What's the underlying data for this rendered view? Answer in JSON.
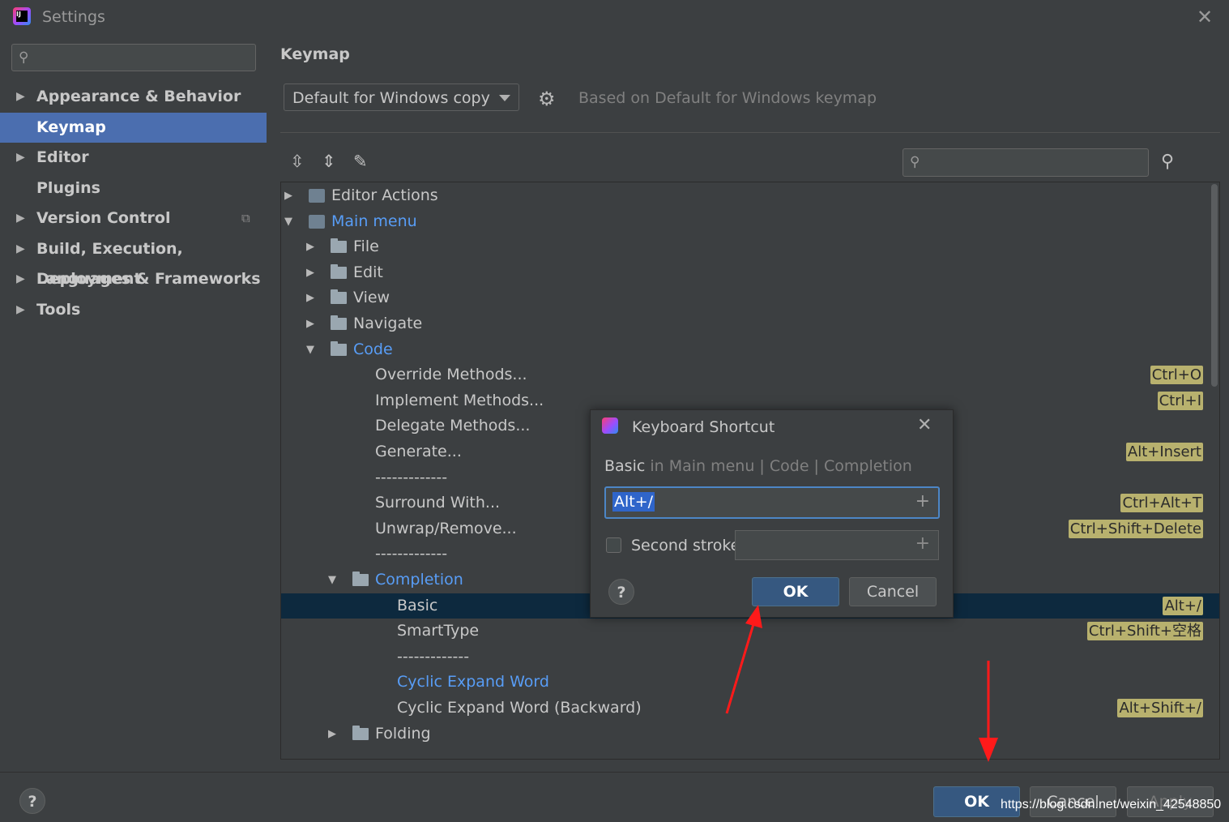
{
  "window": {
    "title": "Settings",
    "close_icon": "close-icon"
  },
  "sidebar": {
    "search_placeholder": "",
    "items": [
      {
        "label": "Appearance & Behavior",
        "expandable": true,
        "selected": false
      },
      {
        "label": "Keymap",
        "expandable": false,
        "selected": true
      },
      {
        "label": "Editor",
        "expandable": true,
        "selected": false
      },
      {
        "label": "Plugins",
        "expandable": false,
        "selected": false
      },
      {
        "label": "Version Control",
        "expandable": true,
        "selected": false
      },
      {
        "label": "Build, Execution, Deployment",
        "expandable": true,
        "selected": false
      },
      {
        "label": "Languages & Frameworks",
        "expandable": true,
        "selected": false
      },
      {
        "label": "Tools",
        "expandable": true,
        "selected": false
      }
    ]
  },
  "main": {
    "title": "Keymap",
    "keymap_value": "Default for Windows copy",
    "based_on": "Based on Default for Windows keymap",
    "tree": [
      {
        "label": "Editor Actions",
        "indent": 0,
        "arrow": "right",
        "icon": "editor",
        "blue": false,
        "shortcut": ""
      },
      {
        "label": "Main menu",
        "indent": 0,
        "arrow": "down",
        "icon": "menu",
        "blue": true,
        "shortcut": ""
      },
      {
        "label": "File",
        "indent": 1,
        "arrow": "right",
        "icon": "folder",
        "blue": false,
        "shortcut": ""
      },
      {
        "label": "Edit",
        "indent": 1,
        "arrow": "right",
        "icon": "folder",
        "blue": false,
        "shortcut": ""
      },
      {
        "label": "View",
        "indent": 1,
        "arrow": "right",
        "icon": "folder",
        "blue": false,
        "shortcut": ""
      },
      {
        "label": "Navigate",
        "indent": 1,
        "arrow": "right",
        "icon": "folder",
        "blue": false,
        "shortcut": ""
      },
      {
        "label": "Code",
        "indent": 1,
        "arrow": "down",
        "icon": "folder",
        "blue": true,
        "shortcut": ""
      },
      {
        "label": "Override Methods...",
        "indent": 2,
        "arrow": "",
        "icon": "",
        "blue": false,
        "shortcut": "Ctrl+O"
      },
      {
        "label": "Implement Methods...",
        "indent": 2,
        "arrow": "",
        "icon": "",
        "blue": false,
        "shortcut": "Ctrl+I"
      },
      {
        "label": "Delegate Methods...",
        "indent": 2,
        "arrow": "",
        "icon": "",
        "blue": false,
        "shortcut": ""
      },
      {
        "label": "Generate...",
        "indent": 2,
        "arrow": "",
        "icon": "",
        "blue": false,
        "shortcut": "Alt+Insert"
      },
      {
        "label": "-------------",
        "indent": 2,
        "arrow": "",
        "icon": "",
        "blue": false,
        "shortcut": ""
      },
      {
        "label": "Surround With...",
        "indent": 2,
        "arrow": "",
        "icon": "",
        "blue": false,
        "shortcut": "Ctrl+Alt+T"
      },
      {
        "label": "Unwrap/Remove...",
        "indent": 2,
        "arrow": "",
        "icon": "",
        "blue": false,
        "shortcut": "Ctrl+Shift+Delete"
      },
      {
        "label": "-------------",
        "indent": 2,
        "arrow": "",
        "icon": "",
        "blue": false,
        "shortcut": ""
      },
      {
        "label": "Completion",
        "indent": 2,
        "arrow": "down",
        "icon": "folder",
        "blue": true,
        "shortcut": ""
      },
      {
        "label": "Basic",
        "indent": 3,
        "arrow": "",
        "icon": "",
        "blue": false,
        "shortcut": "Alt+/",
        "selected": true
      },
      {
        "label": "SmartType",
        "indent": 3,
        "arrow": "",
        "icon": "",
        "blue": false,
        "shortcut": "Ctrl+Shift+空格"
      },
      {
        "label": "-------------",
        "indent": 3,
        "arrow": "",
        "icon": "",
        "blue": false,
        "shortcut": ""
      },
      {
        "label": "Cyclic Expand Word",
        "indent": 3,
        "arrow": "",
        "icon": "",
        "blue": true,
        "shortcut": ""
      },
      {
        "label": "Cyclic Expand Word (Backward)",
        "indent": 3,
        "arrow": "",
        "icon": "",
        "blue": false,
        "shortcut": "Alt+Shift+/"
      },
      {
        "label": "Folding",
        "indent": 2,
        "arrow": "right",
        "icon": "folder",
        "blue": false,
        "shortcut": ""
      },
      {
        "label": "-------------",
        "indent": 2,
        "arrow": "",
        "icon": "",
        "blue": false,
        "shortcut": ""
      }
    ]
  },
  "dialog": {
    "title": "Keyboard Shortcut",
    "path_action": "Basic",
    "path_rest": " in Main menu | Code | Completion",
    "shortcut_value": "Alt+/",
    "second_stroke_label": "Second stroke:",
    "help_label": "?",
    "ok_label": "OK",
    "cancel_label": "Cancel"
  },
  "footer": {
    "help_label": "?",
    "ok_label": "OK",
    "cancel_label": "Cancel",
    "apply_label": "Apply",
    "watermark": "https://blog.csdn.net/weixin_42548850"
  },
  "colors": {
    "selection": "#4b6eaf",
    "tree_selection": "#0d293e",
    "shortcut_badge": "#b8b16e",
    "link_blue": "#589df6",
    "annotation_red": "#ff1a1a"
  }
}
